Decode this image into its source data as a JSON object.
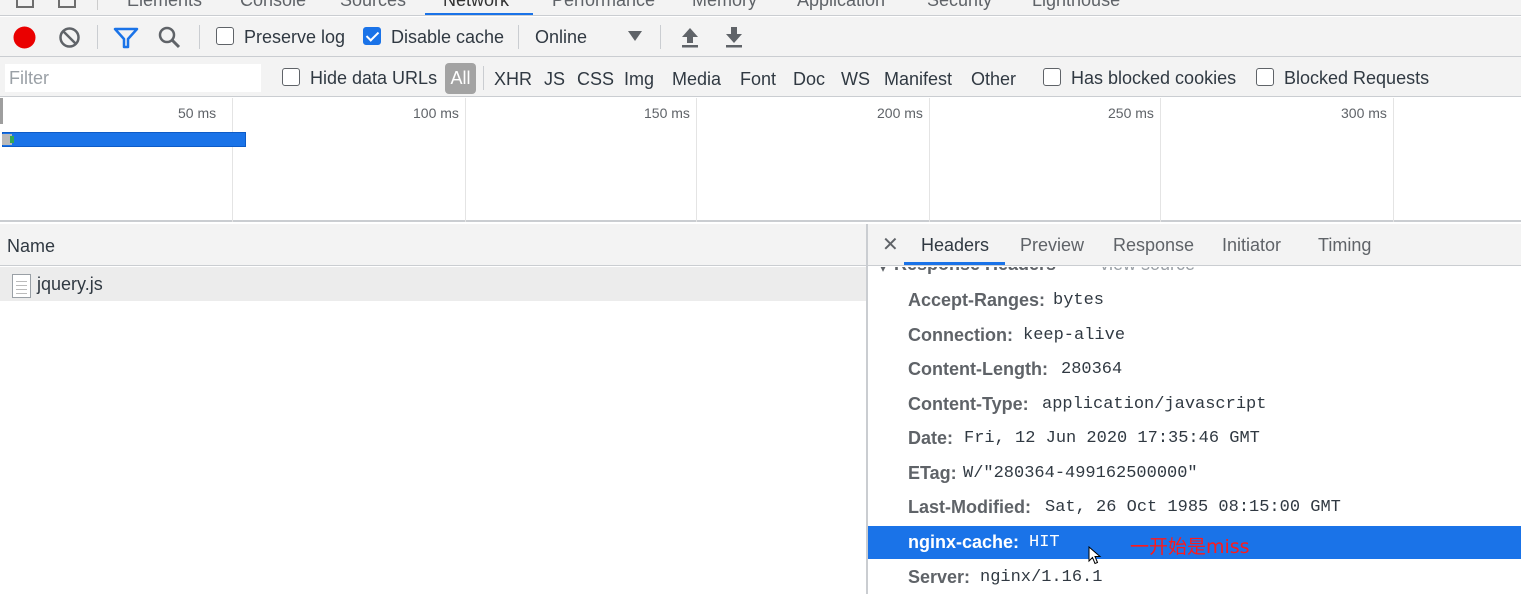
{
  "tabs": [
    {
      "label": "Elements"
    },
    {
      "label": "Console"
    },
    {
      "label": "Sources"
    },
    {
      "label": "Network"
    },
    {
      "label": "Performance"
    },
    {
      "label": "Memory"
    },
    {
      "label": "Application"
    },
    {
      "label": "Security"
    },
    {
      "label": "Lighthouse"
    }
  ],
  "toolbar": {
    "preserve_log": {
      "label": "Preserve log",
      "checked": false
    },
    "disable_cache": {
      "label": "Disable cache",
      "checked": true
    },
    "throttling": "Online",
    "record_color": "#ea0000"
  },
  "filterbar": {
    "placeholder": "Filter",
    "hide_data_urls": "Hide data URLs",
    "types": [
      "All",
      "XHR",
      "JS",
      "CSS",
      "Img",
      "Media",
      "Font",
      "Doc",
      "WS",
      "Manifest",
      "Other"
    ],
    "active_type": "All",
    "has_blocked_cookies": "Has blocked cookies",
    "blocked_requests": "Blocked Requests"
  },
  "overview": {
    "ticks": [
      "50 ms",
      "100 ms",
      "150 ms",
      "200 ms",
      "250 ms",
      "300 ms"
    ]
  },
  "requests": {
    "column_name": "Name",
    "rows": [
      {
        "name": "jquery.js"
      }
    ]
  },
  "details": {
    "tabs": [
      "Headers",
      "Preview",
      "Response",
      "Initiator",
      "Timing"
    ],
    "active_tab": "Headers",
    "section_title": "Response Headers",
    "view_source": "view source",
    "headers": [
      {
        "key": "Accept-Ranges:",
        "value": "bytes"
      },
      {
        "key": "Connection:",
        "value": "keep-alive"
      },
      {
        "key": "Content-Length:",
        "value": "280364"
      },
      {
        "key": "Content-Type:",
        "value": "application/javascript"
      },
      {
        "key": "Date:",
        "value": "Fri, 12 Jun 2020 17:35:46 GMT"
      },
      {
        "key": "ETag:",
        "value": "W/\"280364-499162500000\""
      },
      {
        "key": "Last-Modified:",
        "value": "Sat, 26 Oct 1985 08:15:00 GMT"
      },
      {
        "key": "nginx-cache:",
        "value": "HIT"
      },
      {
        "key": "Server:",
        "value": "nginx/1.16.1"
      }
    ],
    "selected_header": "nginx-cache:",
    "annotation": "一开始是miss"
  }
}
